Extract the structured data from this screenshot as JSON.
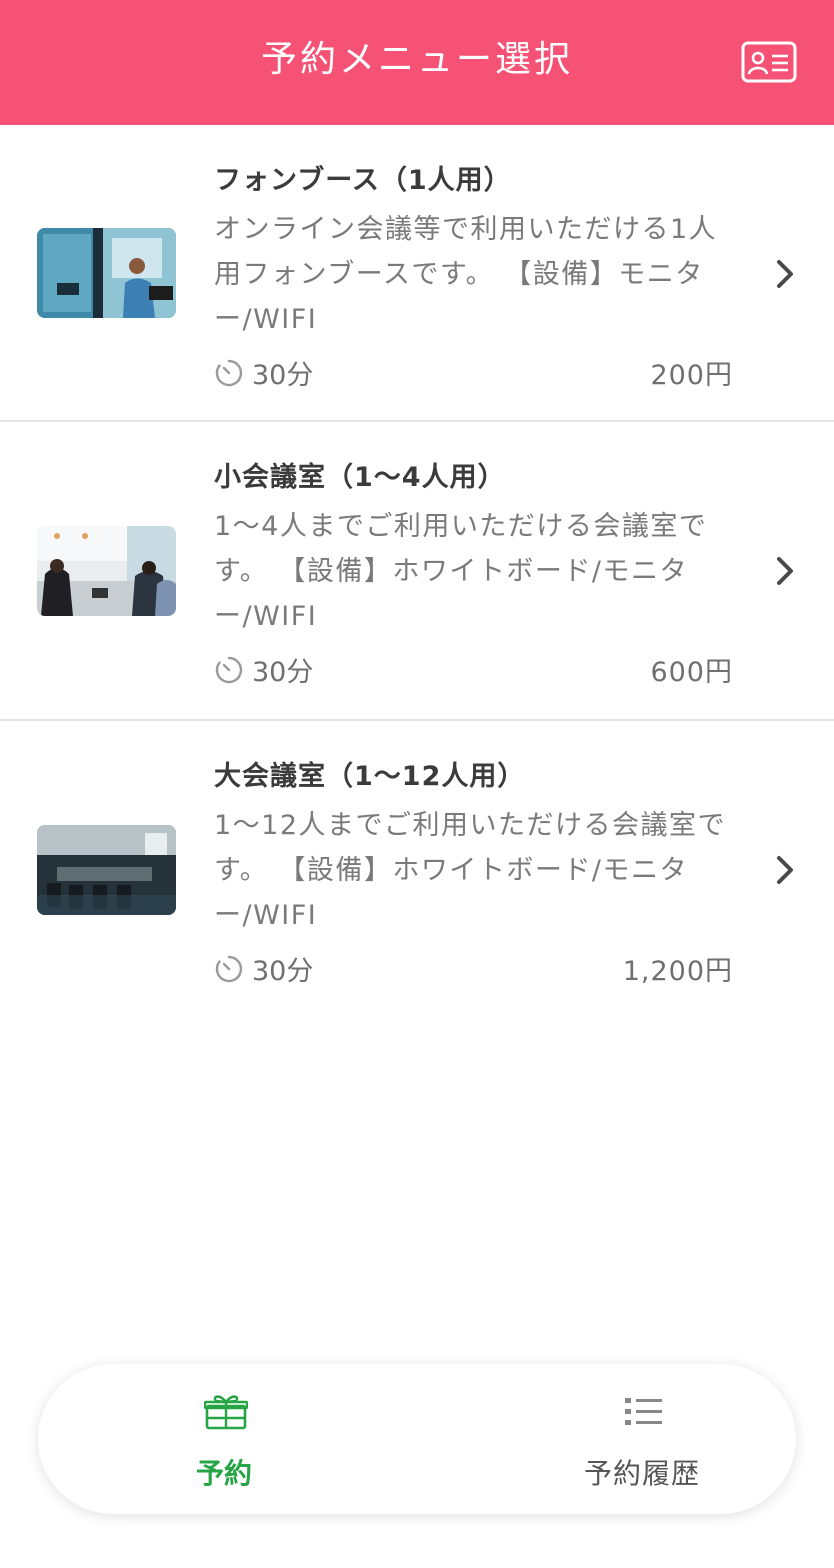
{
  "header": {
    "title": "予約メニュー選択",
    "member_card_icon": "member-card-icon",
    "background_color": "#f55275"
  },
  "menu_items": [
    {
      "title": "フォンブース（1人用）",
      "description": "オンライン会議等で利用いただける1人用フォンブースです。 【設備】モニター/WIFI",
      "duration": "30分",
      "price": "200円",
      "thumbnail": "phone-booth-photo"
    },
    {
      "title": "小会議室（1〜4人用）",
      "description": "1〜4人までご利用いただける会議室です。 【設備】ホワイトボード/モニター/WIFI",
      "duration": "30分",
      "price": "600円",
      "thumbnail": "small-meeting-room-photo"
    },
    {
      "title": "大会議室（1〜12人用）",
      "description": "1〜12人までご利用いただける会議室です。 【設備】ホワイトボード/モニター/WIFI",
      "duration": "30分",
      "price": "1,200円",
      "thumbnail": "large-meeting-room-photo"
    }
  ],
  "bottom_nav": {
    "tabs": [
      {
        "label": "予約",
        "icon": "gift-icon",
        "active": true,
        "color": "#27a546"
      },
      {
        "label": "予約履歴",
        "icon": "list-icon",
        "active": false,
        "color": "#555555"
      }
    ]
  }
}
